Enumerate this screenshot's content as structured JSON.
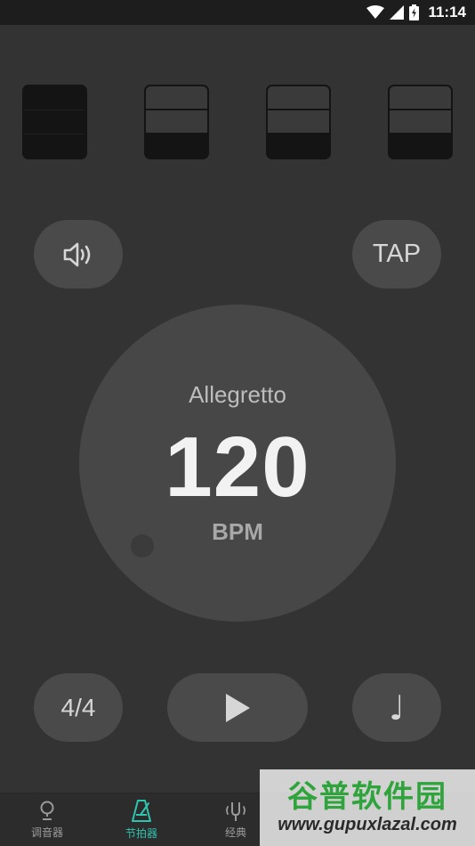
{
  "status_bar": {
    "time": "11:14"
  },
  "beats": [
    {
      "state": "accent"
    },
    {
      "state": "normal"
    },
    {
      "state": "normal"
    },
    {
      "state": "normal"
    }
  ],
  "controls": {
    "tap_label": "TAP",
    "time_signature": "4/4",
    "note_glyph": "♩"
  },
  "tempo": {
    "name": "Allegretto",
    "bpm": "120",
    "unit": "BPM"
  },
  "nav": {
    "items": [
      {
        "label": "调音器",
        "active": false
      },
      {
        "label": "节拍器",
        "active": true
      },
      {
        "label": "经典",
        "active": false
      }
    ]
  },
  "watermark": {
    "title": "谷普软件园",
    "url": "www.gupuxlazal.com"
  },
  "colors": {
    "background": "#333333",
    "accent": "#2ec4b0",
    "button": "#4a4a4a"
  }
}
